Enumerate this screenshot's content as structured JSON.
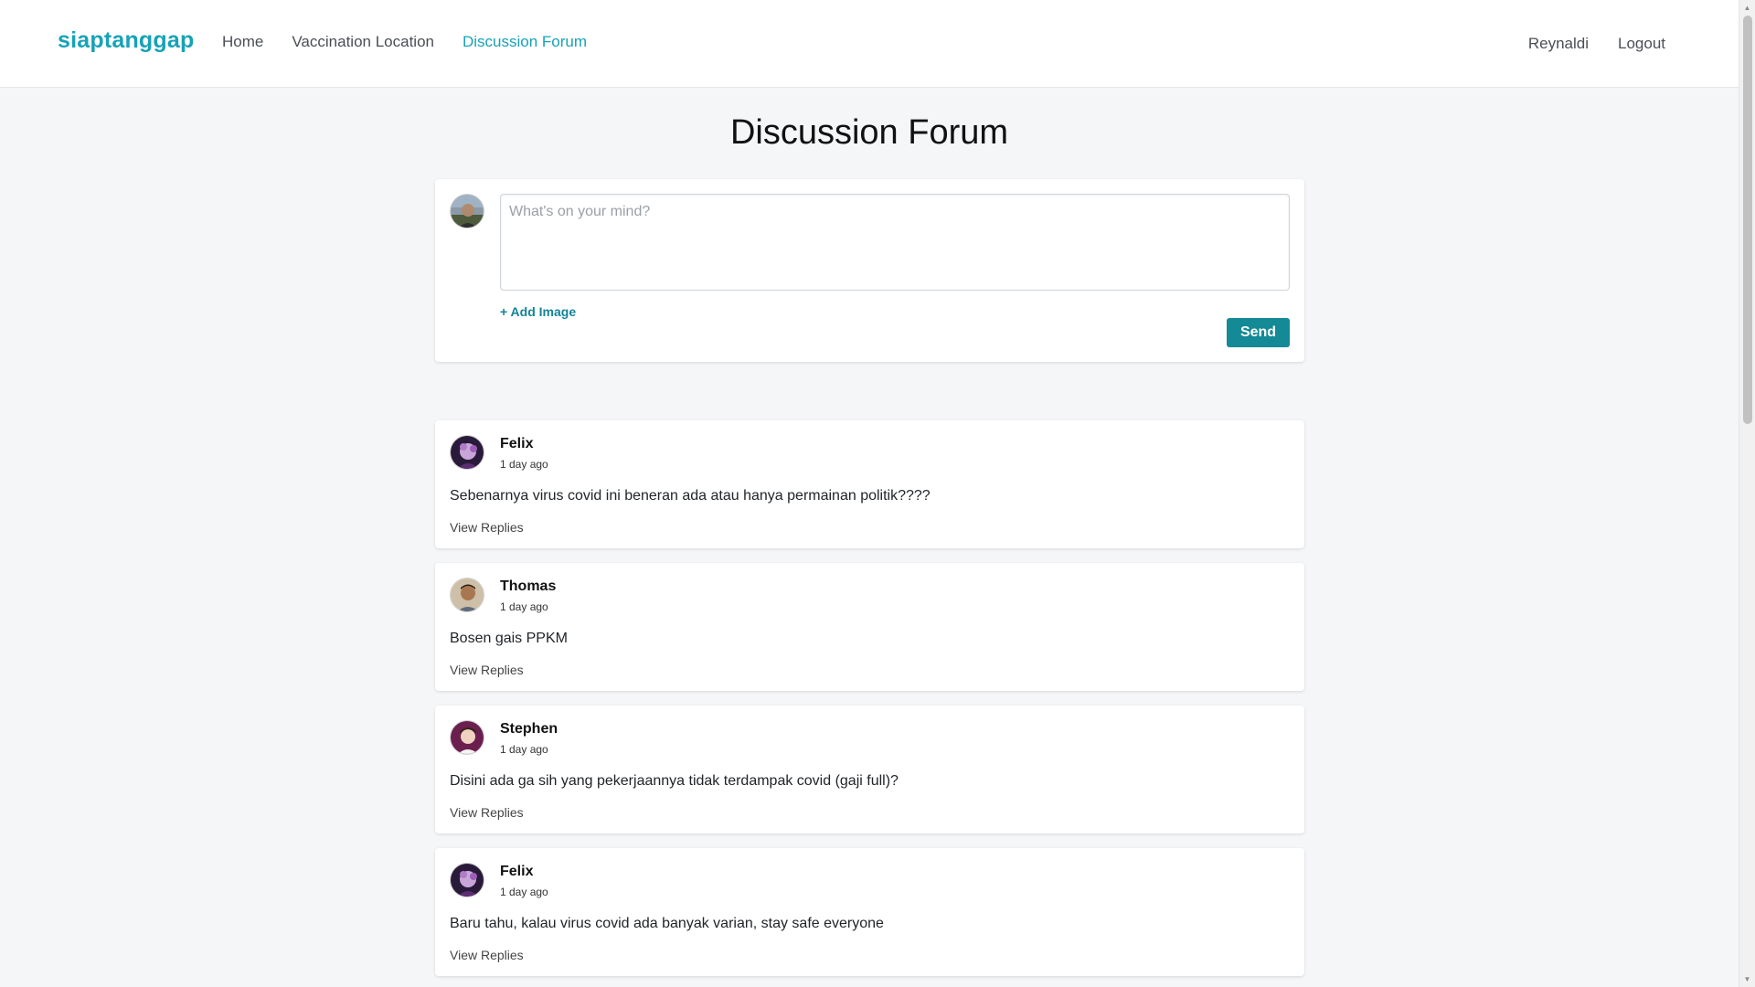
{
  "nav": {
    "brand": "siaptanggap",
    "links": [
      "Home",
      "Vaccination Location",
      "Discussion Forum"
    ],
    "user": "Reynaldi",
    "logout": "Logout"
  },
  "page": {
    "title": "Discussion Forum"
  },
  "composer": {
    "placeholder": "What's on your mind?",
    "add_image": "+ Add Image",
    "send": "Send"
  },
  "posts": [
    {
      "author": "Felix",
      "time": "1 day ago",
      "body": "Sebenarnya virus covid ini beneran ada atau hanya permainan politik????",
      "replies": "View Replies"
    },
    {
      "author": "Thomas",
      "time": "1 day ago",
      "body": "Bosen gais PPKM",
      "replies": "View Replies"
    },
    {
      "author": "Stephen",
      "time": "1 day ago",
      "body": "Disini ada ga sih yang pekerjaannya tidak terdampak covid (gaji full)?",
      "replies": "View Replies"
    },
    {
      "author": "Felix",
      "time": "1 day ago",
      "body": "Baru tahu, kalau virus covid ada banyak varian, stay safe everyone",
      "replies": "View Replies"
    }
  ],
  "colors": {
    "accent": "#17a2b8",
    "button": "#138a96"
  }
}
